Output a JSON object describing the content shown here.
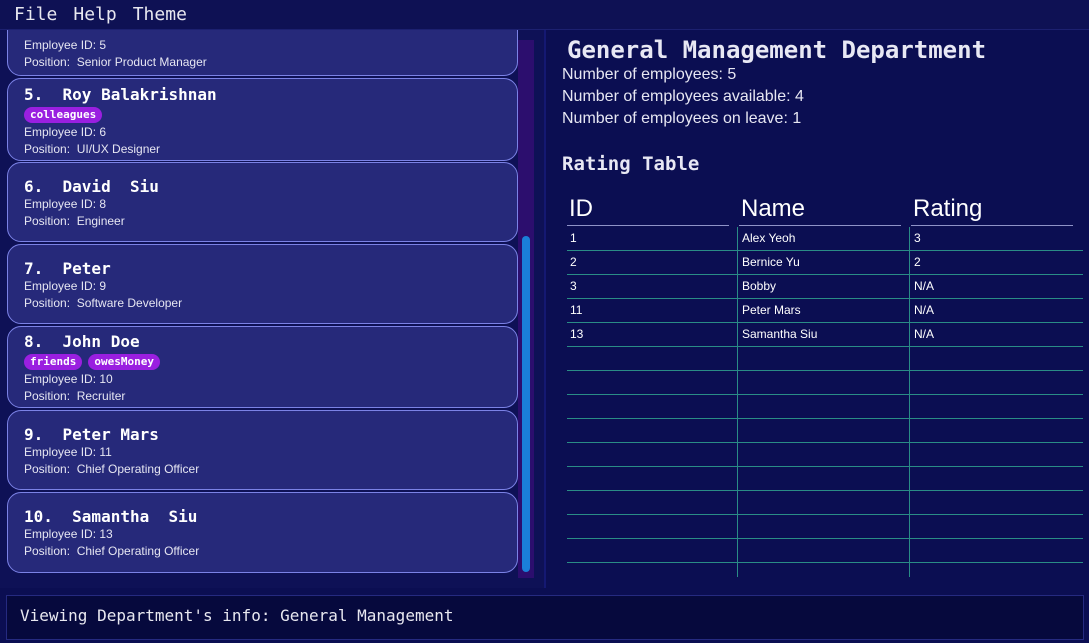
{
  "menu": [
    "File",
    "Help",
    "Theme"
  ],
  "employees": [
    {
      "title": "",
      "tags": [],
      "id_line": "Employee ID: 5",
      "position_line": "Position:  Senior Product Manager"
    },
    {
      "title": "5.  Roy Balakrishnan",
      "tags": [
        "colleagues"
      ],
      "id_line": "Employee ID: 6",
      "position_line": "Position:  UI/UX Designer"
    },
    {
      "title": "6.  David  Siu",
      "tags": [],
      "id_line": "Employee ID: 8",
      "position_line": "Position:  Engineer"
    },
    {
      "title": "7.  Peter",
      "tags": [],
      "id_line": "Employee ID: 9",
      "position_line": "Position:  Software Developer"
    },
    {
      "title": "8.  John Doe",
      "tags": [
        "friends",
        "owesMoney"
      ],
      "id_line": "Employee ID: 10",
      "position_line": "Position:  Recruiter"
    },
    {
      "title": "9.  Peter Mars",
      "tags": [],
      "id_line": "Employee ID: 11",
      "position_line": "Position:  Chief Operating Officer"
    },
    {
      "title": "10.  Samantha  Siu",
      "tags": [],
      "id_line": "Employee ID: 13",
      "position_line": "Position:  Chief Operating Officer"
    }
  ],
  "department": {
    "name": "General Management Department",
    "stats": [
      "Number of employees: 5",
      "Number of employees available: 4",
      "Number of employees on leave: 1"
    ]
  },
  "rating_table": {
    "heading": "Rating Table",
    "columns": [
      "ID",
      "Name",
      "Rating"
    ],
    "rows": [
      [
        "1",
        "Alex Yeoh",
        "3"
      ],
      [
        "2",
        "Bernice Yu",
        "2"
      ],
      [
        "3",
        "Bobby",
        "N/A"
      ],
      [
        "11",
        "Peter Mars",
        "N/A"
      ],
      [
        "13",
        "Samantha  Siu",
        "N/A"
      ]
    ]
  },
  "result": "Viewing Department's info: General Management",
  "colors": {
    "background": "#0b0e52",
    "card": "#26297a",
    "card_border": "#7b82e6",
    "tag": "#9a1fe0",
    "scroll_thumb": "#1a7fd9",
    "table_lines": "#2a8c86"
  }
}
